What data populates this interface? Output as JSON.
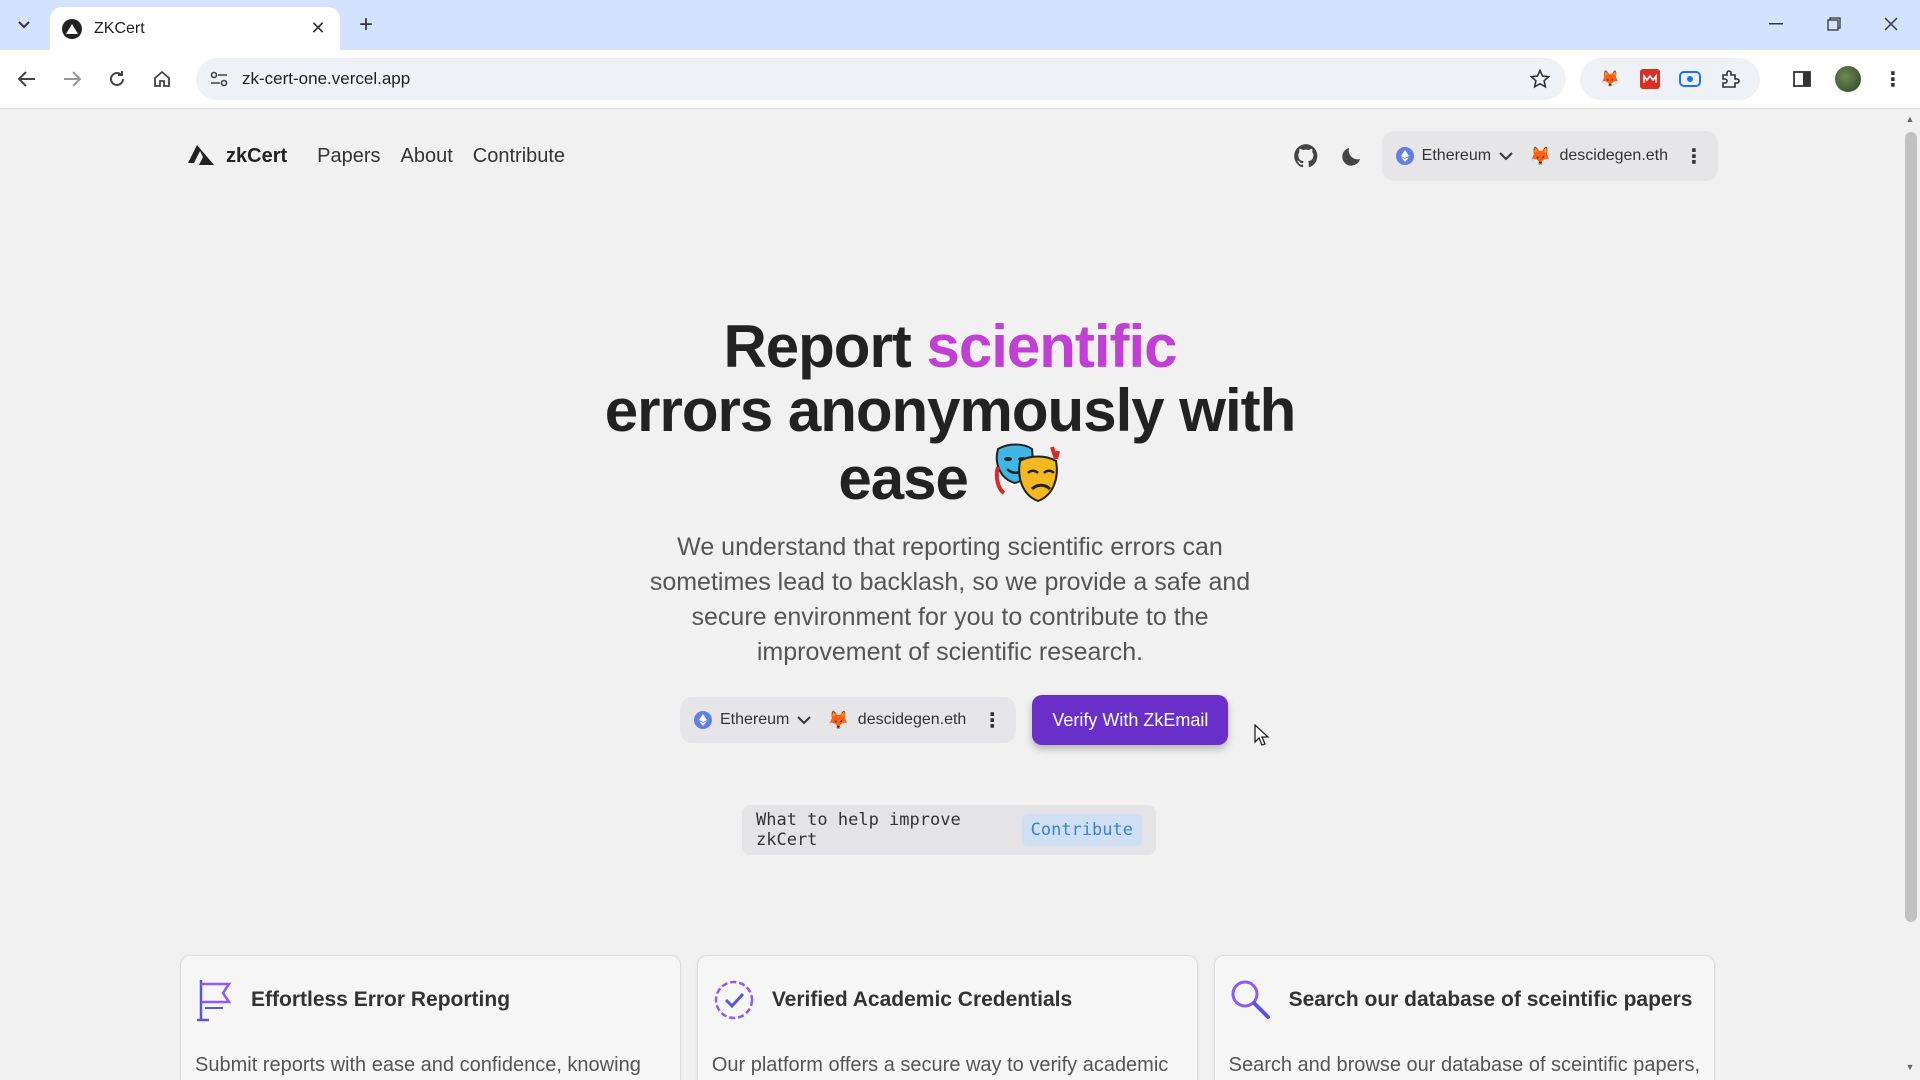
{
  "browser": {
    "tab_title": "ZKCert",
    "url": "zk-cert-one.vercel.app"
  },
  "nav": {
    "brand": "zkCert",
    "links": [
      "Papers",
      "About",
      "Contribute"
    ]
  },
  "wallet": {
    "chain": "Ethereum",
    "account": "descidegen.eth"
  },
  "hero": {
    "title_part1": "Report",
    "title_accent": "scientific",
    "title_part2": "errors anonymously with ease",
    "subtitle": "We understand that reporting scientific errors can sometimes lead to backlash, so we provide a safe and secure environment for you to contribute to the improvement of scientific research.",
    "verify_button": "Verify With ZkEmail"
  },
  "help": {
    "text": "What to help improve zkCert",
    "link": "Contribute"
  },
  "features": [
    {
      "title": "Effortless Error Reporting",
      "text": "Submit reports with ease and confidence, knowing",
      "icon": "flag-icon"
    },
    {
      "title": "Verified Academic Credentials",
      "text": "Our platform offers a secure way to verify academic",
      "icon": "verified-badge-icon"
    },
    {
      "title": "Search our database of sceintific papers",
      "text": "Search and browse our database of sceintific papers,",
      "icon": "search-icon"
    }
  ],
  "colors": {
    "accent": "#c23fd6",
    "button": "#6b2fc9",
    "link": "#3b82c8",
    "chrome": "#d3e3fd"
  }
}
